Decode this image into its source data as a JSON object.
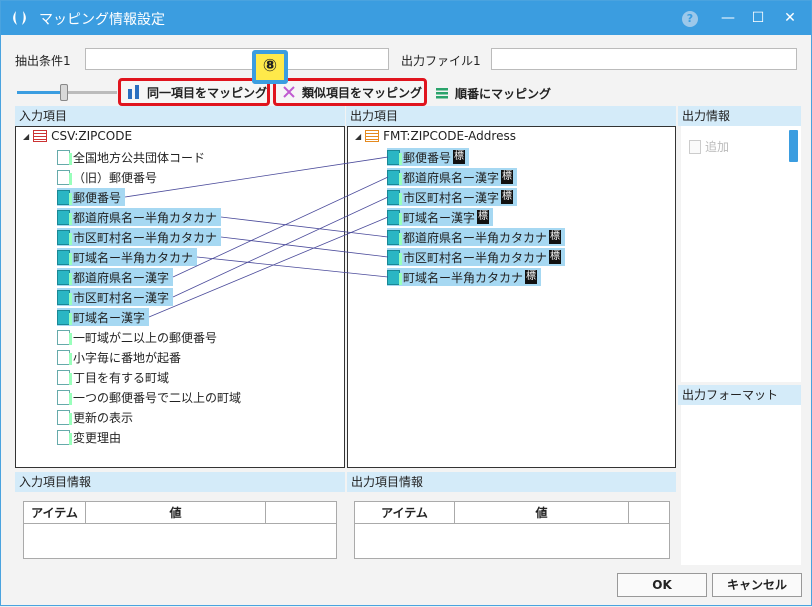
{
  "window": {
    "title": "マッピング情報設定",
    "help": "?",
    "minimize": "—",
    "maximize": "☐",
    "close": "✕"
  },
  "filter": {
    "extract_label": "抽出条件1",
    "extract_value": "",
    "output_label": "出力ファイル1",
    "output_value": ""
  },
  "toolbar": {
    "callout_number": "⑧",
    "same_label": "同一項目をマッピング",
    "similar_label": "類似項目をマッピング",
    "order_label": "順番にマッピング"
  },
  "input": {
    "header": "入力項目",
    "root": "CSV:ZIPCODE",
    "items": [
      {
        "label": "全国地方公共団体コード",
        "mapped": false
      },
      {
        "label": "（旧）郵便番号",
        "mapped": false
      },
      {
        "label": "郵便番号",
        "mapped": true
      },
      {
        "label": "都道府県名ー半角カタカナ",
        "mapped": true
      },
      {
        "label": "市区町村名ー半角カタカナ",
        "mapped": true
      },
      {
        "label": "町域名ー半角カタカナ",
        "mapped": true
      },
      {
        "label": "都道府県名ー漢字",
        "mapped": true
      },
      {
        "label": "市区町村名ー漢字",
        "mapped": true
      },
      {
        "label": "町域名ー漢字",
        "mapped": true
      },
      {
        "label": "一町域が二以上の郵便番号",
        "mapped": false
      },
      {
        "label": "小字毎に番地が起番",
        "mapped": false
      },
      {
        "label": "丁目を有する町域",
        "mapped": false
      },
      {
        "label": "一つの郵便番号で二以上の町域",
        "mapped": false
      },
      {
        "label": "更新の表示",
        "mapped": false
      },
      {
        "label": "変更理由",
        "mapped": false
      }
    ]
  },
  "output": {
    "header": "出力項目",
    "root": "FMT:ZIPCODE-Address",
    "tag": "標",
    "items": [
      {
        "label": "郵便番号"
      },
      {
        "label": "都道府県名ー漢字"
      },
      {
        "label": "市区町村名ー漢字"
      },
      {
        "label": "町域名ー漢字"
      },
      {
        "label": "都道府県名ー半角カタカナ"
      },
      {
        "label": "市区町村名ー半角カタカナ"
      },
      {
        "label": "町域名ー半角カタカナ"
      }
    ]
  },
  "mappings": [
    [
      2,
      0
    ],
    [
      3,
      4
    ],
    [
      4,
      5
    ],
    [
      5,
      6
    ],
    [
      6,
      1
    ],
    [
      7,
      2
    ],
    [
      8,
      3
    ]
  ],
  "side": {
    "info_header": "出力情報",
    "add_label": "追加",
    "format_header": "出力フォーマット"
  },
  "input_info": {
    "header": "入力項目情報",
    "col_item": "アイテム",
    "col_value": "値"
  },
  "output_info": {
    "header": "出力項目情報",
    "col_item": "アイテム",
    "col_value": "値"
  },
  "buttons": {
    "ok": "OK",
    "cancel": "キャンセル"
  }
}
